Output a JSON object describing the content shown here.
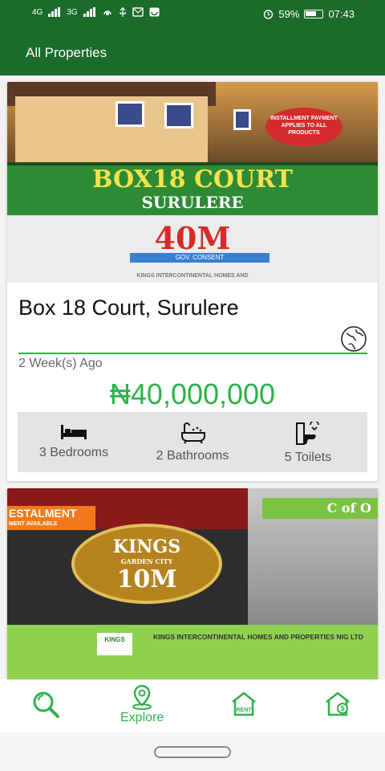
{
  "status_bar": {
    "net1": "4G",
    "net2": "3G",
    "battery": "59%",
    "time": "07:43"
  },
  "app_bar": {
    "title": "All Properties"
  },
  "listings": [
    {
      "banner": {
        "badge": "INSTALLMENT PAYMENT APPLIES TO ALL PRODUCTS",
        "title": "BOX18 COURT",
        "subtitle": "SURULERE",
        "price": "40M",
        "tag": "GOV. CONSENT",
        "footer": "KINGS INTERCONTINENTAL HOMES AND"
      },
      "name": "Box 18 Court, Surulere",
      "posted": "2 Week(s) Ago",
      "price": "₦40,000,000",
      "features": {
        "bedrooms": "3 Bedrooms",
        "bathrooms": "2 Bathrooms",
        "toilets": "5 Toilets"
      }
    },
    {
      "banner": {
        "stripe": "ESTALMENT",
        "stripe_sub": "MENT AVAILABLE",
        "brand": "KINGS",
        "brand_sub": "GARDEN CITY",
        "price": "10M",
        "cofo": "C of O",
        "logo": "KINGS",
        "company": "KINGS INTERCONTINENTAL HOMES AND PROPERTIES NIG LTD"
      }
    }
  ],
  "bottom_nav": {
    "explore_label": "Explore",
    "rent_text": "RENT",
    "sale_symbol": "$"
  },
  "colors": {
    "primary": "#1b6b2a",
    "accent": "#2db34a"
  }
}
